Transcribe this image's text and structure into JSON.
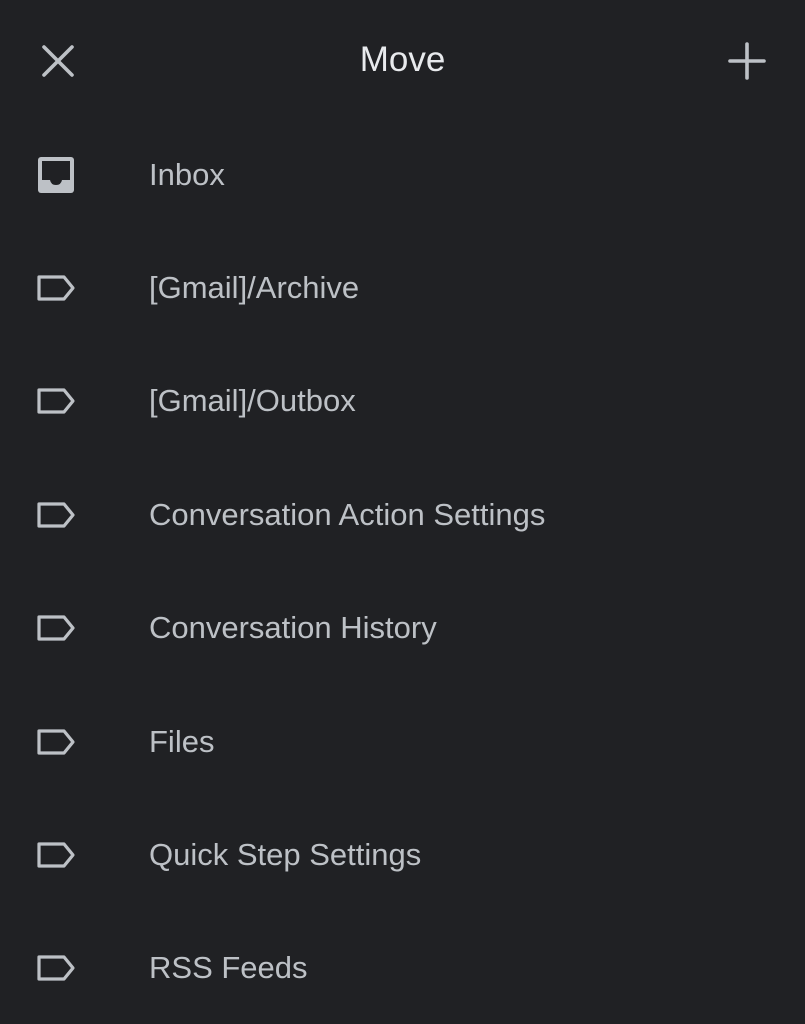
{
  "header": {
    "title": "Move",
    "close_icon": "close-icon",
    "add_icon": "add-icon"
  },
  "folders": [
    {
      "label": "Inbox",
      "icon": "inbox-icon"
    },
    {
      "label": "[Gmail]/Archive",
      "icon": "label-icon"
    },
    {
      "label": "[Gmail]/Outbox",
      "icon": "label-icon"
    },
    {
      "label": "Conversation Action Settings",
      "icon": "label-icon"
    },
    {
      "label": "Conversation History",
      "icon": "label-icon"
    },
    {
      "label": "Files",
      "icon": "label-icon"
    },
    {
      "label": "Quick Step Settings",
      "icon": "label-icon"
    },
    {
      "label": "RSS Feeds",
      "icon": "label-icon"
    }
  ],
  "colors": {
    "background": "#202124",
    "title_text": "#e8eaed",
    "item_text": "#bdc1c6",
    "icon": "#bdc1c6"
  }
}
